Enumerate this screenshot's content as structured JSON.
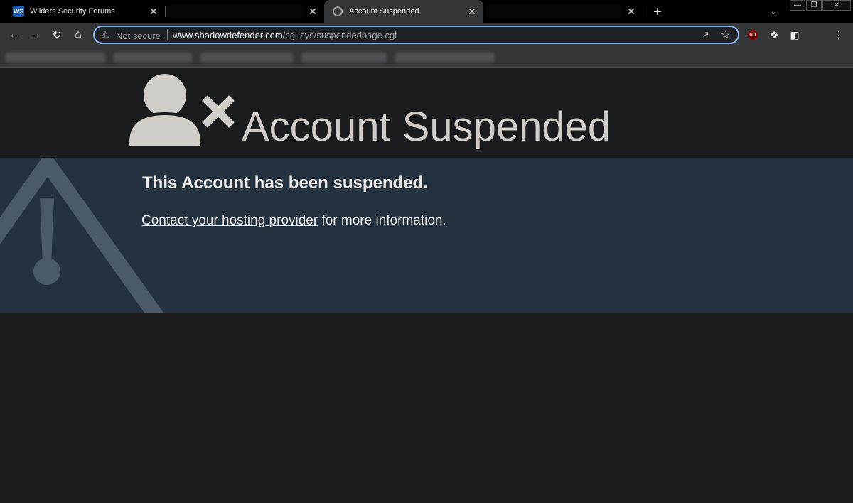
{
  "browser": {
    "tabs": [
      {
        "title": "Wilders Security Forums",
        "favicon": "WS",
        "active": false
      },
      {
        "title": "",
        "redacted": true,
        "active": false
      },
      {
        "title": "Account Suspended",
        "favicon": "globe-icon",
        "active": true
      },
      {
        "title": "",
        "redacted": true,
        "active": false
      }
    ],
    "close_glyph": "✕",
    "new_tab_glyph": "+",
    "window_controls": {
      "minimize": "—",
      "restore": "❐",
      "close": "✕"
    }
  },
  "toolbar": {
    "security_label": "Not secure",
    "url_host": "www.shadowdefender.com",
    "url_path": "/cgi-sys/suspendedpage.cgi",
    "ublock_badge": "uD"
  },
  "page": {
    "title": "Account Suspended",
    "heading": "This Account has been suspended.",
    "link_text": "Contact your hosting provider",
    "trailing_text": " for more information."
  },
  "colors": {
    "banner_bg": "#24313f",
    "title_color": "#d0ccc7",
    "omnibox_focus": "#8ab4f8"
  }
}
